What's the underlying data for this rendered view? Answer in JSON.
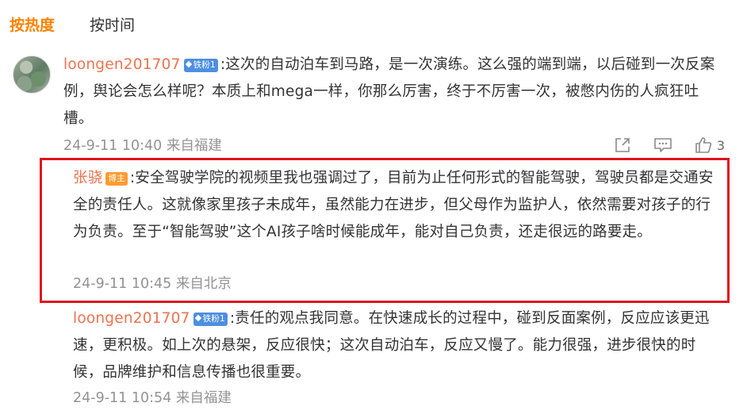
{
  "tabs": {
    "hot": "按热度",
    "time": "按时间"
  },
  "colors": {
    "accent": "#ff8200",
    "username": "#eb7350",
    "fan_badge": "#4d8fe0",
    "blogger_badge": "#ff9b2f",
    "highlight_border": "#e0141e",
    "meta": "#939393"
  },
  "comment": {
    "username": "loongen201707",
    "badge": "铁粉1",
    "text": ":这次的自动泊车到马路，是一次演练。这么强的端到端，以后碰到一次反案例，舆论会怎么样呢？本质上和mega一样，你那么厉害，终于不厉害一次，被憋内伤的人疯狂吐槽。",
    "time": "24-9-11 10:40",
    "location": "来自福建",
    "like_count": "3",
    "icons": [
      "share-icon",
      "comment-icon",
      "like-icon"
    ]
  },
  "replies": [
    {
      "username": "张骁",
      "badge": "博主",
      "text": ":安全驾驶学院的视频里我也强调过了，目前为止任何形式的智能驾驶，驾驶员都是交通安全的责任人。这就像家里孩子未成年，虽然能力在进步，但父母作为监护人，依然需要对孩子的行为负责。至于“智能驾驶”这个AI孩子啥时候能成年，能对自己负责，还走很远的路要走。",
      "time": "24-9-11 10:45",
      "location": "来自北京"
    },
    {
      "username": "loongen201707",
      "badge": "铁粉1",
      "text": ":责任的观点我同意。在快速成长的过程中，碰到反面案例，反应应该更迅速，更积极。如上次的悬架，反应很快；这次自动泊车，反应又慢了。能力很强，进步很快的时候，品牌维护和信息传播也很重要。",
      "time": "24-9-11 10:54",
      "location": "来自福建"
    }
  ]
}
